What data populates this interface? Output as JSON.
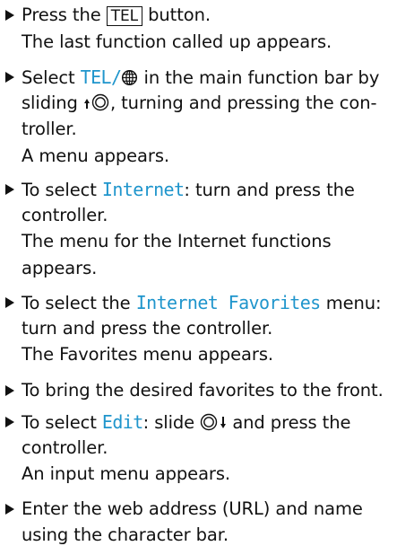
{
  "step1": {
    "pre": "Press the",
    "key_label": "TEL",
    "post": "button.",
    "result": "The last function called up appears."
  },
  "step2": {
    "pre": "Select",
    "menu": "TEL/",
    "post": "in the main function bar by",
    "line2_pre": "sliding",
    "line2_post": ", turning and pressing the con-",
    "line3": "troller.",
    "result": "A menu appears."
  },
  "step3": {
    "pre": "To select",
    "item": "Internet",
    "post": ": turn and press the",
    "line2": "controller.",
    "result_line1": "The menu for the Internet functions",
    "result_line2": "appears."
  },
  "step4": {
    "pre": "To select the",
    "item": "Internet Favorites",
    "post": "menu:",
    "line2": "turn and press the controller.",
    "result": "The Favorites menu appears."
  },
  "step5": {
    "text": "To bring the desired favorites to the front."
  },
  "step6": {
    "pre": "To select",
    "item": "Edit",
    "post_a": ": slide",
    "post_b": "and press the",
    "line2": "controller.",
    "result": "An input menu appears."
  },
  "step7": {
    "line1": "Enter the web address (URL) and name",
    "line2": "using the character bar."
  },
  "colors": {
    "display_text": "#1f95cc",
    "body_text": "#111111"
  },
  "icons": [
    "bullet-triangle-icon",
    "globe-icon",
    "controller-slide-up-icon",
    "controller-slide-down-icon"
  ]
}
